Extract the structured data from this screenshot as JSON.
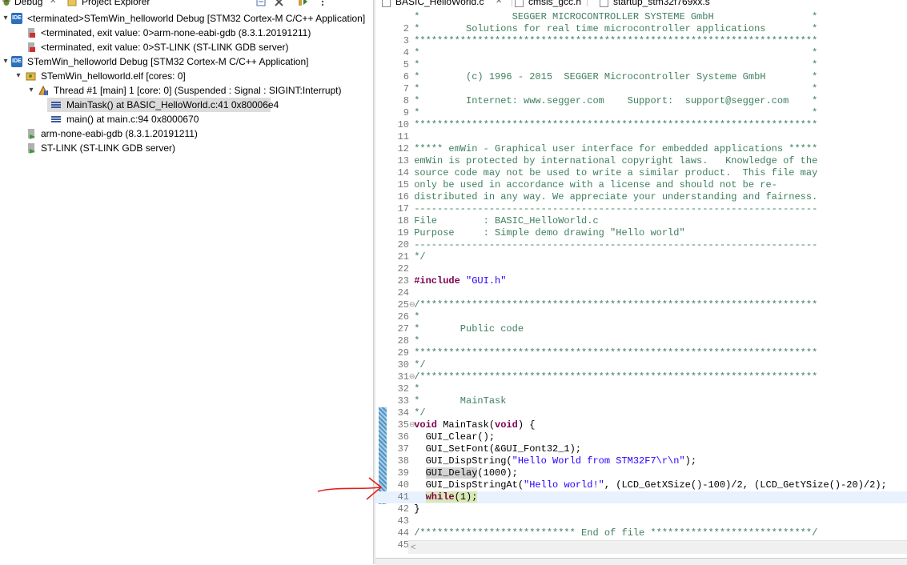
{
  "debug_view": {
    "tabs": [
      {
        "label": "Debug",
        "close": "✕"
      },
      {
        "label": "Project Explorer"
      }
    ],
    "tree": [
      {
        "label": "<terminated>STemWin_helloworld Debug [STM32 Cortex-M C/C++ Application]",
        "icon": "ide-launch-icon",
        "icon_text": "IDE"
      },
      {
        "label": "<terminated, exit value: 0>arm-none-eabi-gdb (8.3.1.20191211)",
        "icon": "terminated-process-icon"
      },
      {
        "label": "<terminated, exit value: 0>ST-LINK (ST-LINK GDB server)",
        "icon": "terminated-process-icon"
      },
      {
        "label": "STemWin_helloworld Debug [STM32 Cortex-M C/C++ Application]",
        "icon": "ide-launch-icon",
        "icon_text": "IDE"
      },
      {
        "label": "STemWin_helloworld.elf [cores: 0]",
        "icon": "debug-target-icon"
      },
      {
        "label": "Thread #1 [main] 1 [core: 0] (Suspended : Signal : SIGINT:Interrupt)",
        "icon": "suspended-thread-icon"
      },
      {
        "label": "MainTask() at BASIC_HelloWorld.c:41 0x80006e4",
        "icon": "stack-frame-icon"
      },
      {
        "label": "main() at main.c:94 0x8000670",
        "icon": "stack-frame-icon"
      },
      {
        "label": "arm-none-eabi-gdb (8.3.1.20191211)",
        "icon": "process-icon"
      },
      {
        "label": "ST-LINK (ST-LINK GDB server)",
        "icon": "process-icon"
      }
    ]
  },
  "editor": {
    "tabs": [
      {
        "label": "BASIC_HelloWorld.c",
        "close": "✕"
      },
      {
        "label": "cmsis_gcc.h"
      },
      {
        "label": "startup_stm32f769xx.s"
      }
    ],
    "lines": [
      {
        "n": "",
        "t": " *                SEGGER MICROCONTROLLER SYSTEME GmbH                 *"
      },
      {
        "n": "2",
        "t": " *        Solutions for real time microcontroller applications        *"
      },
      {
        "n": "3",
        "t": " **********************************************************************"
      },
      {
        "n": "4",
        "t": " *                                                                    *"
      },
      {
        "n": "5",
        "t": " *                                                                    *"
      },
      {
        "n": "6",
        "t": " *        (c) 1996 - 2015  SEGGER Microcontroller Systeme GmbH        *"
      },
      {
        "n": "7",
        "t": " *                                                                    *"
      },
      {
        "n": "8",
        "t": " *        Internet: www.segger.com    Support:  support@segger.com    *"
      },
      {
        "n": "9",
        "t": " *                                                                    *"
      },
      {
        "n": "10",
        "t": " **********************************************************************"
      },
      {
        "n": "11",
        "t": ""
      },
      {
        "n": "12",
        "t": " ***** emWin - Graphical user interface for embedded applications *****"
      },
      {
        "n": "13",
        "t": " emWin is protected by international copyright laws.   Knowledge of the"
      },
      {
        "n": "14",
        "t": " source code may not be used to write a similar product.  This file may"
      },
      {
        "n": "15",
        "t": " only be used in accordance with a license and should not be re-"
      },
      {
        "n": "16",
        "t": " distributed in any way. We appreciate your understanding and fairness."
      },
      {
        "n": "17",
        "t": " ----------------------------------------------------------------------"
      },
      {
        "n": "18",
        "t": " File        : BASIC_HelloWorld.c"
      },
      {
        "n": "19",
        "t": " Purpose     : Simple demo drawing \"Hello world\""
      },
      {
        "n": "20",
        "t": " ----------------------------------------------------------------------"
      },
      {
        "n": "21",
        "t": " */"
      },
      {
        "n": "22",
        "t": ""
      },
      {
        "n": "23",
        "t": " #include \"GUI.h\""
      },
      {
        "n": "24",
        "t": ""
      },
      {
        "n": "25",
        "t": " /*********************************************************************",
        "fold": "⊖"
      },
      {
        "n": "26",
        "t": " *"
      },
      {
        "n": "27",
        "t": " *       Public code"
      },
      {
        "n": "28",
        "t": " *"
      },
      {
        "n": "29",
        "t": " **********************************************************************"
      },
      {
        "n": "30",
        "t": " */"
      },
      {
        "n": "31",
        "t": " /*********************************************************************",
        "fold": "⊖"
      },
      {
        "n": "32",
        "t": " *"
      },
      {
        "n": "33",
        "t": " *       MainTask"
      },
      {
        "n": "34",
        "t": " */"
      },
      {
        "n": "35",
        "t": " void MainTask(void) {",
        "fold": "⊖"
      },
      {
        "n": "36",
        "t": "   GUI_Clear();"
      },
      {
        "n": "37",
        "t": "   GUI_SetFont(&GUI_Font32_1);"
      },
      {
        "n": "38",
        "t": "   GUI_DispString(\"Hello World from STM32F7\\r\\n\");"
      },
      {
        "n": "39",
        "t": "   GUI_Delay(1000);"
      },
      {
        "n": "40",
        "t": "   GUI_DispStringAt(\"Hello world!\", (LCD_GetXSize()-100)/2, (LCD_GetYSize()-20)/2);"
      },
      {
        "n": "41",
        "t": "   while(1);"
      },
      {
        "n": "42",
        "t": " }"
      },
      {
        "n": "43",
        "t": ""
      },
      {
        "n": "44",
        "t": " /*************************** End of file ****************************/"
      },
      {
        "n": "45",
        "t": ""
      }
    ],
    "current_line": "41",
    "scroll_left_glyph": "<"
  },
  "colors": {
    "comment": "#3f7f5f",
    "keyword": "#7f0055",
    "string": "#2a00ff",
    "current_line_bg": "#e8f2fe",
    "selected_frame_bg": "#dcdcdc",
    "annotation_arrow": "#e0201a"
  }
}
